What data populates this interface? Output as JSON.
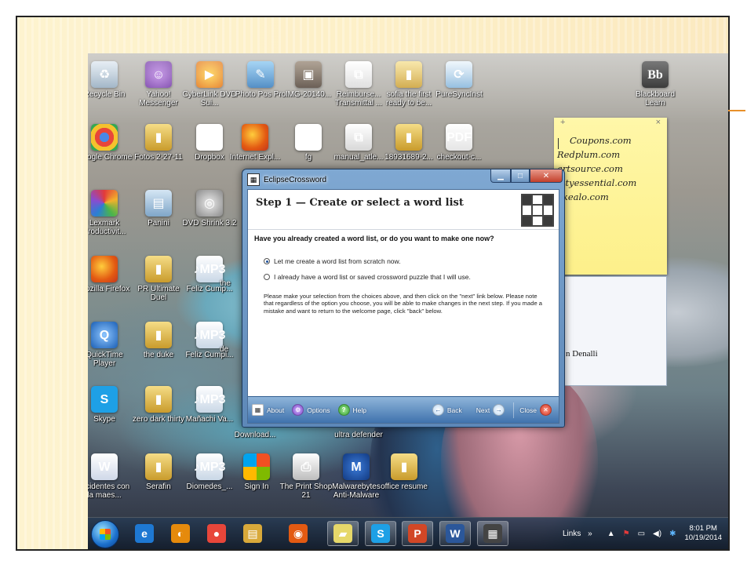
{
  "desktop_icons": [
    {
      "label": "Recycle Bin",
      "icon": "recycle-bin-icon"
    },
    {
      "label": "Yahoo! Messenger",
      "icon": "yahoo-messenger-icon"
    },
    {
      "label": "CyberLink DVD Sui...",
      "icon": "cyberlink-icon"
    },
    {
      "label": "Photo Pos Pro",
      "icon": "photo-pos-icon"
    },
    {
      "label": "IMG-20140...",
      "icon": "image-file-icon"
    },
    {
      "label": "Reimburse... Transmittal ...",
      "icon": "pdf-file-icon"
    },
    {
      "label": "sofia the first ready to be...",
      "icon": "folder-icon"
    },
    {
      "label": "PureSyncInst",
      "icon": "installer-icon"
    },
    {
      "label": "Blackboard Learn",
      "icon": "blackboard-icon"
    },
    {
      "label": "Google Chrome",
      "icon": "chrome-icon"
    },
    {
      "label": "Fotos 2-27-11",
      "icon": "folder-icon"
    },
    {
      "label": "Dropbox",
      "icon": "dropbox-icon"
    },
    {
      "label": "Internet Expl...",
      "icon": "firefox-icon"
    },
    {
      "label": "fg",
      "icon": "internet-explorer-icon"
    },
    {
      "label": "manual_atle...",
      "icon": "pdf-file-icon"
    },
    {
      "label": "18931689-2...",
      "icon": "folder-icon"
    },
    {
      "label": "checkout-c...",
      "icon": "pdf-file-icon"
    },
    {
      "label": "Lexmark Productivit...",
      "icon": "lexmark-icon"
    },
    {
      "label": "Panini",
      "icon": "panini-icon"
    },
    {
      "label": "DVD Shrink 3.2",
      "icon": "dvd-shrink-icon"
    },
    {
      "label": "Mozilla Firefox",
      "icon": "firefox-icon"
    },
    {
      "label": "PR Ultimate Duel",
      "icon": "folder-icon"
    },
    {
      "label": "Feliz Cump...",
      "icon": "mp3-file-icon"
    },
    {
      "label": "the",
      "icon": "folder-icon"
    },
    {
      "label": "QuickTime Player",
      "icon": "quicktime-icon"
    },
    {
      "label": "the duke",
      "icon": "folder-icon"
    },
    {
      "label": "Feliz Cumpl...",
      "icon": "mp3-file-icon"
    },
    {
      "label": "de",
      "icon": "folder-icon"
    },
    {
      "label": "Skype",
      "icon": "skype-icon"
    },
    {
      "label": "zero dark thirty",
      "icon": "folder-icon"
    },
    {
      "label": "Mañachi Va...",
      "icon": "mp3-file-icon"
    },
    {
      "label": "Download...",
      "icon": "folder-icon"
    },
    {
      "label": "ultra defender",
      "icon": "folder-icon"
    },
    {
      "label": "Incidentes con la maes...",
      "icon": "word-doc-icon"
    },
    {
      "label": "Serafin",
      "icon": "folder-icon"
    },
    {
      "label": "Diomedes_...",
      "icon": "mp3-file-icon"
    },
    {
      "label": "Sign In",
      "icon": "microsoft-sign-in-icon"
    },
    {
      "label": "The Print Shop 21",
      "icon": "print-shop-icon"
    },
    {
      "label": "Malwarebytes Anti-Malware",
      "icon": "malwarebytes-icon"
    },
    {
      "label": "office resume",
      "icon": "folder-icon"
    }
  ],
  "sticky_note": {
    "add": "+",
    "close": "×",
    "lines": [
      "Coupons.com",
      "Redplum.com",
      "artsource.com",
      "altyessential.com",
      "akealo.com"
    ]
  },
  "background_window": {
    "text": "n Denalli"
  },
  "dialog": {
    "title": "EclipseCrossword",
    "window_buttons": {
      "minimize": "▁",
      "maximize": "□",
      "close": "✕"
    },
    "heading": "Step 1 — Create or select a word list",
    "question": "Have you already created a word list, or do you want to make one now?",
    "options": [
      {
        "label": "Let me create a word list from scratch now.",
        "selected": true
      },
      {
        "label": "I already have a word list or saved crossword puzzle that I will use.",
        "selected": false
      }
    ],
    "note": "Please make your selection from the choices above, and then click on the \"next\" link below. Please note that regardless of the option you choose, you will be able to make changes in the next step.  If you made a mistake and want to return to the welcome page, click \"back\" below.",
    "footer": {
      "about": "About",
      "options": "Options",
      "help": "Help",
      "back": "Back",
      "next": "Next",
      "close": "Close"
    }
  },
  "taskbar": {
    "apps": [
      {
        "name": "internet-explorer",
        "glyph": "e",
        "color": "#1e78d2"
      },
      {
        "name": "cyberlink",
        "glyph": "◐",
        "color": "#e58a0c"
      },
      {
        "name": "chrome",
        "glyph": "●",
        "color": "#e8463a"
      },
      {
        "name": "file-explorer",
        "glyph": "▤",
        "color": "#d9a93a"
      },
      {
        "name": "firefox",
        "glyph": "◉",
        "color": "#e35a12"
      },
      {
        "name": "sticky-notes",
        "glyph": "▰",
        "color": "#e6d86a"
      },
      {
        "name": "skype",
        "glyph": "S",
        "color": "#1ea0e6"
      },
      {
        "name": "powerpoint",
        "glyph": "P",
        "color": "#d24726"
      },
      {
        "name": "word",
        "glyph": "W",
        "color": "#2b579a"
      },
      {
        "name": "eclipsecrossword",
        "glyph": "▦",
        "color": "#444444"
      }
    ],
    "links": "Links",
    "chevron": "»",
    "tray_up": "▲",
    "time": "8:01 PM",
    "date": "10/19/2014"
  }
}
